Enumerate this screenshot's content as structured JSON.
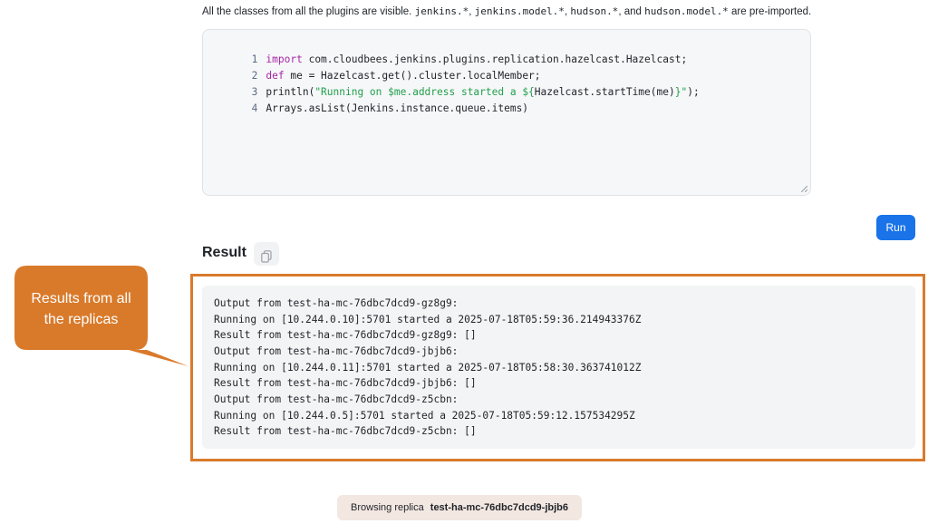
{
  "info": {
    "prefix": "All the classes from all the plugins are visible.",
    "imports": [
      "jenkins.*",
      "jenkins.model.*",
      "hudson.*",
      "hudson.model.*"
    ],
    "sep1": ", ",
    "sep2": ", ",
    "sep3": ", and ",
    "suffix": " are pre-imported."
  },
  "editor": {
    "lines": [
      {
        "num": "1",
        "keyword": "import",
        "rest": " com.cloudbees.jenkins.plugins.replication.hazelcast.Hazelcast;"
      },
      {
        "num": "2",
        "keyword": "def",
        "rest": " me = Hazelcast.get().cluster.localMember;"
      },
      {
        "num": "3",
        "before": "println(",
        "string1": "\"Running on $me.address started a ${",
        "middle": "Hazelcast.startTime(me)",
        "string2": "}\"",
        "after": ");"
      },
      {
        "num": "4",
        "text": "Arrays.asList(Jenkins.instance.queue.items)"
      }
    ]
  },
  "run_button": {
    "label": "Run"
  },
  "result": {
    "title": "Result",
    "copy_icon": "copy-icon",
    "output": [
      "Output from test-ha-mc-76dbc7dcd9-gz8g9:",
      "Running on [10.244.0.10]:5701 started a 2025-07-18T05:59:36.214943376Z",
      "Result from test-ha-mc-76dbc7dcd9-gz8g9: []",
      "Output from test-ha-mc-76dbc7dcd9-jbjb6:",
      "Running on [10.244.0.11]:5701 started a 2025-07-18T05:58:30.363741012Z",
      "Result from test-ha-mc-76dbc7dcd9-jbjb6: []",
      "Output from test-ha-mc-76dbc7dcd9-z5cbn:",
      "Running on [10.244.0.5]:5701 started a 2025-07-18T05:59:12.157534295Z",
      "Result from test-ha-mc-76dbc7dcd9-z5cbn: []"
    ]
  },
  "callout": {
    "line1": "Results from all",
    "line2": "the replicas",
    "color": "#d97a2b"
  },
  "status": {
    "label": "Browsing replica",
    "replica": "test-ha-mc-76dbc7dcd9-jbjb6"
  },
  "colors": {
    "accent": "#1a73e8",
    "highlight": "#d97a2b"
  }
}
